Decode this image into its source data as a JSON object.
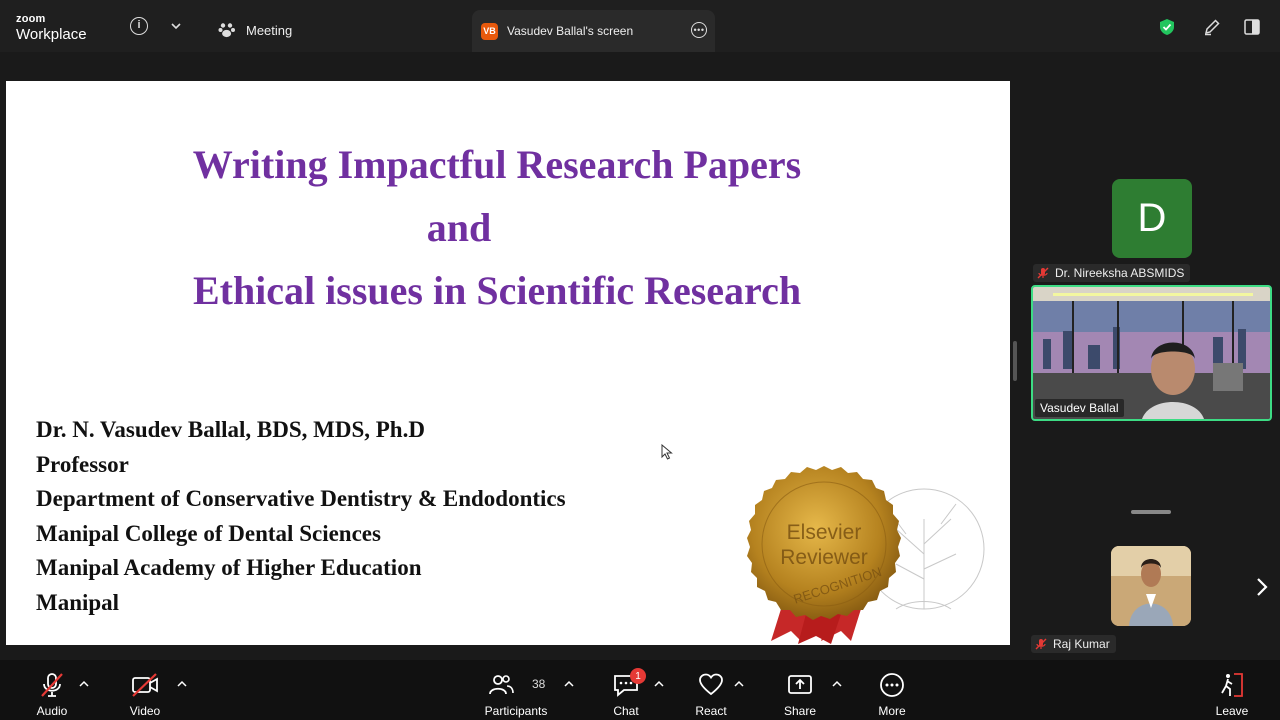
{
  "app": {
    "brand_top": "zoom",
    "brand_bottom": "Workplace"
  },
  "topbar": {
    "meeting_tab_label": "Meeting",
    "screen_tab_badge": "VB",
    "screen_tab_label": "Vasudev Ballal's screen"
  },
  "slide": {
    "title_lines": [
      "Writing Impactful Research Papers",
      "and",
      "Ethical issues in Scientific Research"
    ],
    "author_lines": [
      "Dr. N. Vasudev Ballal, BDS, MDS, Ph.D",
      "Professor",
      "Department of Conservative Dentistry & Endodontics",
      "Manipal College of Dental Sciences",
      "Manipal Academy of Higher Education",
      "Manipal"
    ],
    "badge_line1": "Elsevier",
    "badge_line2": "Reviewer",
    "badge_ring": "RECOGNITION"
  },
  "participants_panel": {
    "avatar_initial": "D",
    "participant1_name": "Dr. Nireeksha ABSMIDS",
    "speaker_name": "Vasudev Ballal",
    "participant3_name": "Raj Kumar"
  },
  "toolbar": {
    "audio_label": "Audio",
    "video_label": "Video",
    "participants_label": "Participants",
    "participants_count": "38",
    "chat_label": "Chat",
    "chat_badge": "1",
    "react_label": "React",
    "share_label": "Share",
    "more_label": "More",
    "leave_label": "Leave"
  },
  "colors": {
    "title_purple": "#7030a0",
    "active_speaker_border": "#3ddc84",
    "avatar_green": "#2e7d32",
    "leave_red": "#e53935",
    "badge_orange": "#e8590c"
  }
}
